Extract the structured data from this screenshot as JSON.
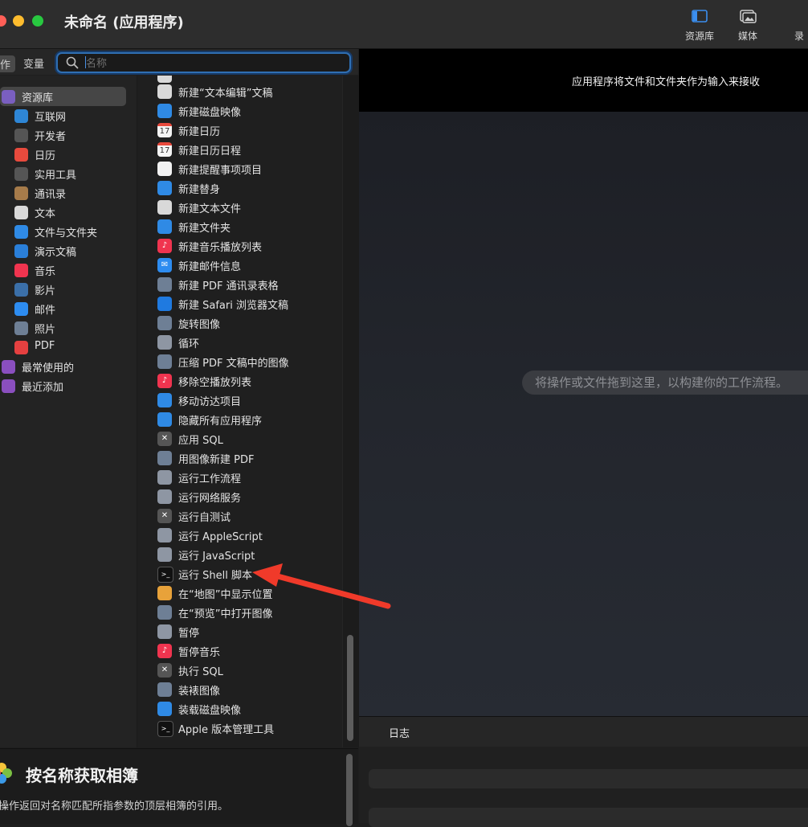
{
  "window": {
    "title": "未命名 (应用程序)",
    "toolbar": [
      {
        "label": "资源库",
        "icon": "library-sidebar-icon"
      },
      {
        "label": "媒体",
        "icon": "media-photo-icon"
      },
      {
        "label": "录",
        "icon": "record-icon"
      }
    ]
  },
  "left_tabs": {
    "actions": "作",
    "variables": "变量"
  },
  "search": {
    "placeholder": "名称",
    "value": ""
  },
  "categories": [
    {
      "label": "资源库",
      "icon": "library-books-icon",
      "color": "#7a5fc0",
      "selected": true
    },
    {
      "label": "互联网",
      "icon": "globe-icon",
      "color": "#2e86d6"
    },
    {
      "label": "开发者",
      "icon": "developer-tools-icon",
      "color": "#555555"
    },
    {
      "label": "日历",
      "icon": "calendar-icon",
      "color": "#e84a3d"
    },
    {
      "label": "实用工具",
      "icon": "utilities-icon",
      "color": "#555555"
    },
    {
      "label": "通讯录",
      "icon": "contacts-icon",
      "color": "#a67b4a"
    },
    {
      "label": "文本",
      "icon": "text-edit-icon",
      "color": "#d9d9d9"
    },
    {
      "label": "文件与文件夹",
      "icon": "finder-icon",
      "color": "#2f8ae5"
    },
    {
      "label": "演示文稿",
      "icon": "keynote-icon",
      "color": "#2a7fd9"
    },
    {
      "label": "音乐",
      "icon": "music-icon",
      "color": "#f0344f"
    },
    {
      "label": "影片",
      "icon": "quicktime-icon",
      "color": "#3b6fa8"
    },
    {
      "label": "邮件",
      "icon": "mail-icon",
      "color": "#2d8cf0"
    },
    {
      "label": "照片",
      "icon": "preview-photo-icon",
      "color": "#6e7f95"
    },
    {
      "label": "PDF",
      "icon": "pdf-icon",
      "color": "#e54040"
    },
    {
      "label": "最常使用的",
      "icon": "folder-purple-icon",
      "color": "#8a4fbf"
    },
    {
      "label": "最近添加",
      "icon": "folder-purple-icon",
      "color": "#8a4fbf"
    }
  ],
  "actions": [
    {
      "label": "新建“文本编辑”文稿",
      "icon": "text-edit-icon",
      "color": "#d9d9d9"
    },
    {
      "label": "新建磁盘映像",
      "icon": "finder-icon",
      "color": "#2f8ae5"
    },
    {
      "label": "新建日历",
      "icon": "calendar-icon",
      "color": "#e84a3d",
      "glyph": "17"
    },
    {
      "label": "新建日历日程",
      "icon": "calendar-icon",
      "color": "#e84a3d",
      "glyph": "17"
    },
    {
      "label": "新建提醒事项项目",
      "icon": "reminders-icon",
      "color": "#f2f2f2"
    },
    {
      "label": "新建替身",
      "icon": "finder-icon",
      "color": "#2f8ae5"
    },
    {
      "label": "新建文本文件",
      "icon": "text-edit-icon",
      "color": "#d9d9d9"
    },
    {
      "label": "新建文件夹",
      "icon": "finder-icon",
      "color": "#2f8ae5"
    },
    {
      "label": "新建音乐播放列表",
      "icon": "music-icon",
      "color": "#f0344f",
      "glyph": "♪"
    },
    {
      "label": "新建邮件信息",
      "icon": "mail-icon",
      "color": "#2d8cf0",
      "glyph": "✉"
    },
    {
      "label": "新建 PDF 通讯录表格",
      "icon": "preview-photo-icon",
      "color": "#6e7f95"
    },
    {
      "label": "新建 Safari 浏览器文稿",
      "icon": "safari-icon",
      "color": "#1f7ae0"
    },
    {
      "label": "旋转图像",
      "icon": "preview-photo-icon",
      "color": "#6e7f95"
    },
    {
      "label": "循环",
      "icon": "automator-icon",
      "color": "#8e96a3"
    },
    {
      "label": "压缩 PDF 文稿中的图像",
      "icon": "preview-photo-icon",
      "color": "#6e7f95"
    },
    {
      "label": "移除空播放列表",
      "icon": "music-icon",
      "color": "#f0344f",
      "glyph": "♪"
    },
    {
      "label": "移动访达项目",
      "icon": "finder-icon",
      "color": "#2f8ae5"
    },
    {
      "label": "隐藏所有应用程序",
      "icon": "finder-icon",
      "color": "#2f8ae5"
    },
    {
      "label": "应用 SQL",
      "icon": "developer-tools-icon",
      "color": "#555555",
      "glyph": "✕"
    },
    {
      "label": "用图像新建 PDF",
      "icon": "preview-photo-icon",
      "color": "#6e7f95"
    },
    {
      "label": "运行工作流程",
      "icon": "automator-icon",
      "color": "#8e96a3"
    },
    {
      "label": "运行网络服务",
      "icon": "automator-icon",
      "color": "#8e96a3"
    },
    {
      "label": "运行自测试",
      "icon": "developer-tools-icon",
      "color": "#555555",
      "glyph": "✕"
    },
    {
      "label": "运行 AppleScript",
      "icon": "automator-icon",
      "color": "#8e96a3"
    },
    {
      "label": "运行 JavaScript",
      "icon": "automator-icon",
      "color": "#8e96a3"
    },
    {
      "label": "运行 Shell 脚本",
      "icon": "terminal-icon",
      "color": "#111111",
      "glyph": ">_"
    },
    {
      "label": "在“地图”中显示位置",
      "icon": "photos-icon",
      "color": "#e8a23a"
    },
    {
      "label": "在“预览”中打开图像",
      "icon": "preview-photo-icon",
      "color": "#6e7f95"
    },
    {
      "label": "暂停",
      "icon": "automator-icon",
      "color": "#8e96a3"
    },
    {
      "label": "暂停音乐",
      "icon": "music-icon",
      "color": "#f0344f",
      "glyph": "♪"
    },
    {
      "label": "执行 SQL",
      "icon": "developer-tools-icon",
      "color": "#555555",
      "glyph": "✕"
    },
    {
      "label": "装裱图像",
      "icon": "preview-photo-icon",
      "color": "#6e7f95"
    },
    {
      "label": "装载磁盘映像",
      "icon": "finder-icon",
      "color": "#2f8ae5"
    },
    {
      "label": "Apple 版本管理工具",
      "icon": "terminal-icon",
      "color": "#111111",
      "glyph": ">_"
    }
  ],
  "description": {
    "title": "按名称获取相簿",
    "text": "操作返回对名称匹配所指参数的顶层相簿的引用。",
    "icon": "photos-icon"
  },
  "workflow": {
    "header": "应用程序将文件和文件夹作为输入来接收",
    "hint": "将操作或文件拖到这里，以构建你的工作流程。"
  },
  "log": {
    "title": "日志"
  },
  "annotation": {
    "icon": "red-arrow-icon",
    "color": "#f03a2a"
  }
}
